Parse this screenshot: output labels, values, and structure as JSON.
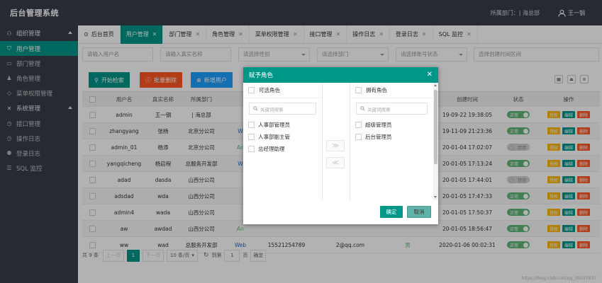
{
  "app": {
    "title": "后台管理系统"
  },
  "header": {
    "dept_label": "所属部门：",
    "dept_value": "| 海总部",
    "username": "王一钢"
  },
  "sidebar": {
    "groups": [
      {
        "label": "组织管理",
        "items": [
          {
            "label": "用户管理",
            "active": true
          },
          {
            "label": "部门管理"
          },
          {
            "label": "角色管理"
          },
          {
            "label": "菜单权限管理"
          }
        ]
      },
      {
        "label": "系统管理",
        "items": [
          {
            "label": "接口管理"
          },
          {
            "label": "操作日志"
          },
          {
            "label": "登录日志"
          },
          {
            "label": "SQL 监控"
          }
        ]
      }
    ]
  },
  "tabs": [
    {
      "label": "后台首页",
      "home": true
    },
    {
      "label": "用户管理",
      "active": true
    },
    {
      "label": "部门管理"
    },
    {
      "label": "角色管理"
    },
    {
      "label": "菜单权限管理"
    },
    {
      "label": "接口管理"
    },
    {
      "label": "操作日志"
    },
    {
      "label": "登录日志"
    },
    {
      "label": "SQL 监控"
    }
  ],
  "filters": {
    "username_ph": "请输入用户名",
    "realname_ph": "请输入真实名称",
    "gender_ph": "请选择性别",
    "dept_ph": "请选择部门",
    "status_ph": "请选择账号状态",
    "time_ph": "选择创建时间区间"
  },
  "buttons": {
    "search": "开始检索",
    "delete": "批量删除",
    "add": "新增用户"
  },
  "table": {
    "headers": [
      "用户名",
      "真实名称",
      "所属部门",
      "",
      "",
      "",
      "",
      "创建时间",
      "状态",
      "操作"
    ],
    "op_labels": {
      "grant": "授权",
      "edit": "编辑",
      "delete": "删除"
    },
    "rows": [
      {
        "username": "admin",
        "realname": "王一钢",
        "dept": "| 海总部",
        "type": "",
        "phone": "",
        "email": "",
        "gender": "",
        "created": "19-09-22 19:38:05",
        "status": "正常",
        "on": true
      },
      {
        "username": "zhangyang",
        "realname": "张杨",
        "dept": "北京分公司",
        "type": "W",
        "phone": "",
        "email": "",
        "gender": "",
        "created": "19-11-09 21:23:36",
        "status": "正常",
        "on": true
      },
      {
        "username": "admin_01",
        "realname": "杨添",
        "dept": "北京分公司",
        "type": "An",
        "phone": "",
        "email": "",
        "gender": "",
        "created": "20-01-04 17:02:07",
        "status": "禁用",
        "on": false
      },
      {
        "username": "yangqicheng",
        "realname": "杨启程",
        "dept": "总服务开发部",
        "type": "W",
        "phone": "",
        "email": "",
        "gender": "",
        "created": "20-01-05 17:13:24",
        "status": "正常",
        "on": true
      },
      {
        "username": "adad",
        "realname": "dasda",
        "dept": "山西分公司",
        "type": "",
        "phone": "",
        "email": "",
        "gender": "",
        "created": "20-01-05 17:44:01",
        "status": "禁用",
        "on": false
      },
      {
        "username": "adsdad",
        "realname": "wda",
        "dept": "山西分公司",
        "type": "",
        "phone": "",
        "email": "",
        "gender": "",
        "created": "20-01-05 17:47:33",
        "status": "正常",
        "on": true
      },
      {
        "username": "admin4",
        "realname": "wada",
        "dept": "山西分公司",
        "type": "",
        "phone": "",
        "email": "",
        "gender": "",
        "created": "20-01-05 17:50:37",
        "status": "正常",
        "on": true
      },
      {
        "username": "aw",
        "realname": "awdad",
        "dept": "山西分公司",
        "type": "An",
        "phone": "",
        "email": "",
        "gender": "",
        "created": "20-01-05 18:56:47",
        "status": "正常",
        "on": true
      },
      {
        "username": "ww",
        "realname": "wad",
        "dept": "总服务开发部",
        "type": "Web",
        "phone": "15521254789",
        "email": "2@qq.com",
        "gender": "男",
        "created": "2020-01-06 00:02:31",
        "status": "正常",
        "on": true
      }
    ]
  },
  "pager": {
    "total": "共 9 条",
    "prev": "上一页",
    "page": "1",
    "next": "下一页",
    "per_page": "10 条/页",
    "goto": "到第",
    "goto_value": "1",
    "page_unit": "页",
    "confirm": "确定"
  },
  "watermark": "https://blog.csdn.net/qq_39337837",
  "modal": {
    "title": "赋予角色",
    "left_title": "可选角色",
    "right_title": "拥有角色",
    "search_ph": "关键词搜索",
    "left_items": [
      "人事部管理员",
      "人事部副主管",
      "总经理助理"
    ],
    "right_items": [
      "超级管理员",
      "后台管理员"
    ],
    "to_right": "≫",
    "to_left": "≪",
    "confirm": "确定",
    "cancel": "取消"
  }
}
